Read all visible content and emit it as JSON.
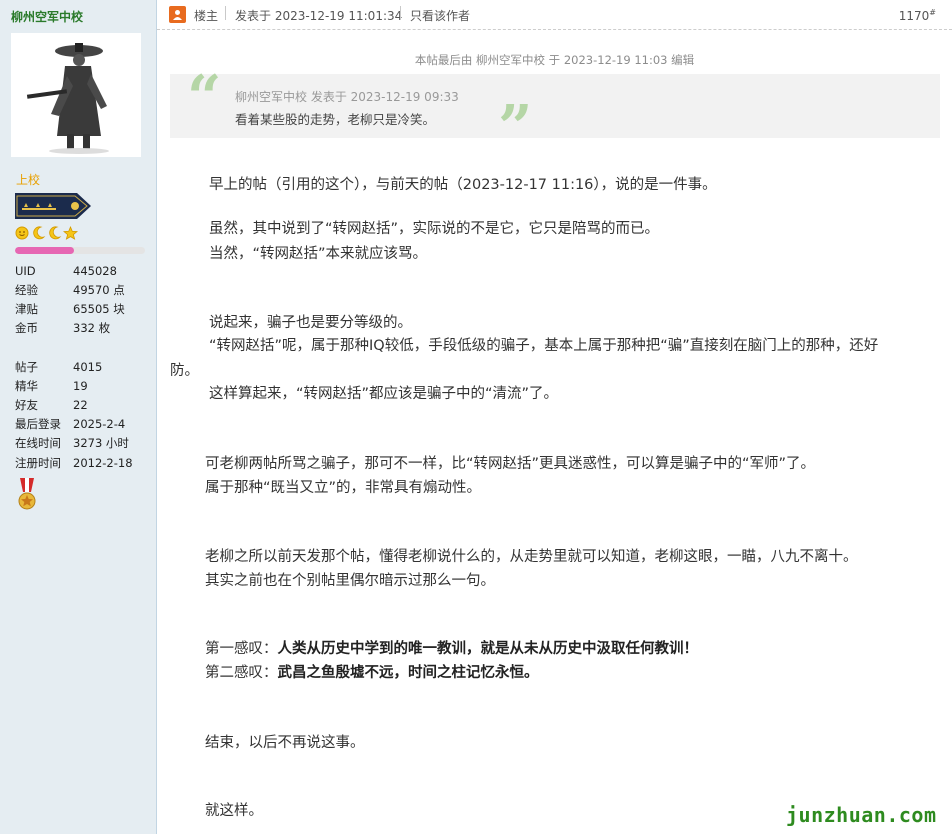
{
  "author": {
    "name": "柳州空军中校",
    "rank_title": "上校",
    "level_progress_percent": 45,
    "stats": [
      {
        "label": "UID",
        "value": "445028"
      },
      {
        "label": "经验",
        "value": "49570 点"
      },
      {
        "label": "津贴",
        "value": "65505 块"
      },
      {
        "label": "金币",
        "value": "332 枚"
      }
    ],
    "stats2": [
      {
        "label": "帖子",
        "value": "4015"
      },
      {
        "label": "精华",
        "value": "19"
      },
      {
        "label": "好友",
        "value": "22"
      },
      {
        "label": "最后登录",
        "value": "2025-2-4"
      },
      {
        "label": "在线时间",
        "value": "3273 小时"
      },
      {
        "label": "注册时间",
        "value": "2012-2-18"
      }
    ],
    "icons": [
      "avatar-swordsman-icon",
      "rank-shoulder-badge-icon",
      "sun-icon",
      "moon-icon",
      "moon-icon",
      "star-icon",
      "medal-icon"
    ]
  },
  "header": {
    "host_label": "楼主",
    "posted_at": "发表于 2023-12-19 11:01:34",
    "only_author": "只看该作者",
    "floor": "1170",
    "floor_suffix": "#"
  },
  "edit_notice": "本帖最后由 柳州空军中校 于 2023-12-19 11:03 编辑",
  "quote": {
    "meta": "柳州空军中校 发表于 2023-12-19 09:33",
    "text": "看着某些股的走势，老柳只是冷笑。"
  },
  "body": {
    "l1": "早上的帖（引用的这个），与前天的帖（2023-12-17 11:16），说的是一件事。",
    "l2": "虽然，其中说到了“转网赵括”，实际说的不是它，它只是陪骂的而已。",
    "l3": "当然，“转网赵括”本来就应该骂。",
    "l4": "说起来，骗子也是要分等级的。",
    "l5": "“转网赵括”呢，属于那种IQ较低，手段低级的骗子，基本上属于那种把“骗”直接刻在脑门上的那种，还好",
    "l6": "防。",
    "l7": "这样算起来，“转网赵括”都应该是骗子中的“清流”了。",
    "l8": "可老柳两帖所骂之骗子，那可不一样，比“转网赵括”更具迷惑性，可以算是骗子中的“军师”了。",
    "l9": "属于那种“既当又立”的，非常具有煽动性。",
    "l10": "老柳之所以前天发那个帖，懂得老柳说什么的，从走势里就可以知道，老柳这眼，一瞄，八九不离十。",
    "l11": "其实之前也在个别帖里偶尔暗示过那么一句。",
    "l12_prefix": "第一感叹：",
    "l12_bold": "人类从历史中学到的唯一教训，就是从未从历史中汲取任何教训！",
    "l13_prefix": "第二感叹：",
    "l13_bold": "武昌之鱼殷墟不远，时间之柱记忆永恒。",
    "l14": "结束，以后不再说这事。",
    "l15": "就这样。"
  },
  "watermark": "junzhuan.com",
  "colors": {
    "sidebar_bg": "#e5edf2",
    "author_name": "#2a7a2a",
    "rank_title": "#e8a000",
    "level_fill": "#e667b3",
    "quote_mark": "#b5d6a6",
    "watermark": "#2e8b1f"
  }
}
